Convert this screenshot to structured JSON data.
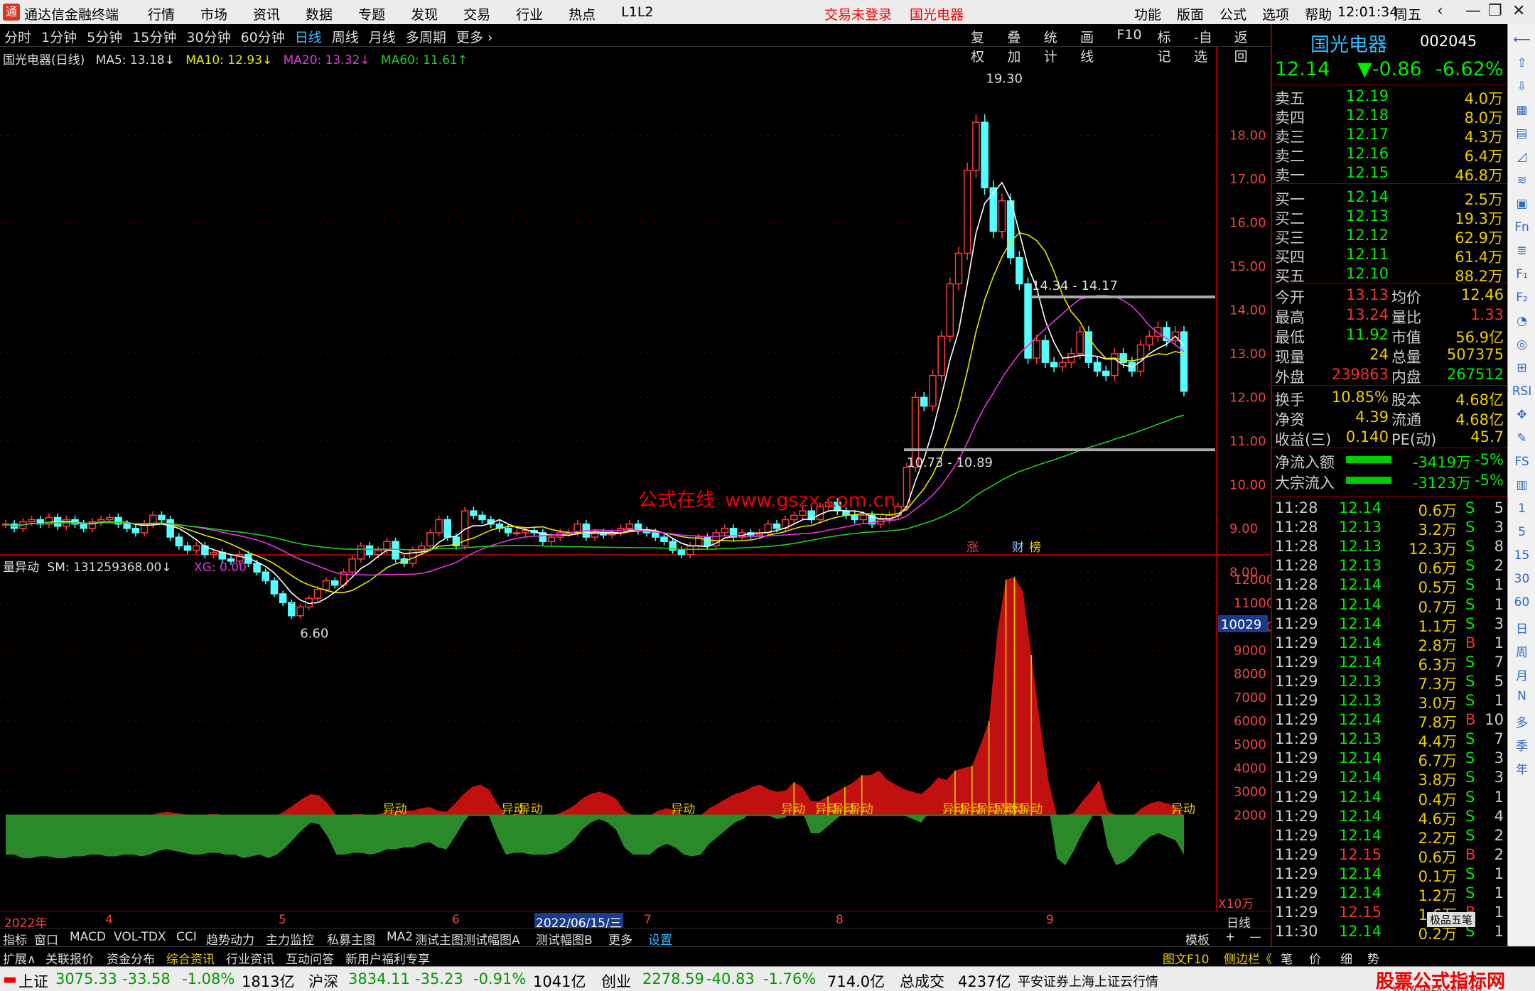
{
  "app": {
    "title": "通达信金融终端",
    "logo": "通",
    "menu": [
      "行情",
      "市场",
      "资讯",
      "数据",
      "专题",
      "发现",
      "交易",
      "行业",
      "热点",
      "L1L2"
    ],
    "status_red": "交易未登录",
    "stock_red": "国光电器",
    "right_menu": [
      "功能",
      "版面",
      "公式",
      "选项",
      "帮助"
    ],
    "clock": "12:01:34",
    "weekday": "周五",
    "window_buttons": [
      "‹",
      "—",
      "❐",
      "✕"
    ]
  },
  "period_tabs": [
    "分时",
    "1分钟",
    "5分钟",
    "15分钟",
    "30分钟",
    "60分钟",
    "日线",
    "周线",
    "月线",
    "多周期",
    "更多 ›"
  ],
  "active_period": "日线",
  "tools": [
    "复权",
    "叠加",
    "统计",
    "画线",
    "F10",
    "标记",
    "-自选",
    "返回"
  ],
  "legend": {
    "stock": "国光电器(日线)",
    "ma5": "MA5: 13.18↓",
    "ma10": "MA10: 12.93↓",
    "ma20": "MA20: 13.32↓",
    "ma60": "MA60: 11.61↑"
  },
  "chart_data": [
    {
      "type": "candlestick",
      "axis_ticks": [
        "18.00",
        "17.00",
        "16.00",
        "15.00",
        "14.00",
        "13.00",
        "12.00",
        "11.00",
        "10.00",
        "9.00",
        "8.00"
      ],
      "ylim": [
        7.5,
        19.7
      ],
      "annotations": {
        "high": "19.30",
        "low": "6.60",
        "upper_band": "14.34 - 14.17",
        "lower_band": "10.73 - 10.89"
      },
      "marks": [
        "涨",
        "财",
        "榜"
      ],
      "closes": [
        9.1,
        9.0,
        9.15,
        9.2,
        9.1,
        9.25,
        9.05,
        9.2,
        9.1,
        9.0,
        9.15,
        9.2,
        9.25,
        9.1,
        9.0,
        8.9,
        9.1,
        9.3,
        9.2,
        8.8,
        8.6,
        8.5,
        8.6,
        8.4,
        8.45,
        8.3,
        8.25,
        8.4,
        8.2,
        8.0,
        7.8,
        7.5,
        7.3,
        7.0,
        7.2,
        7.4,
        7.6,
        7.8,
        7.7,
        8.0,
        8.3,
        8.6,
        8.4,
        8.5,
        8.7,
        8.3,
        8.2,
        8.5,
        8.6,
        8.9,
        9.2,
        8.8,
        8.6,
        9.4,
        9.3,
        9.2,
        9.1,
        9.0,
        8.9,
        8.9,
        8.95,
        8.9,
        8.7,
        8.8,
        8.9,
        8.9,
        9.1,
        8.8,
        8.9,
        8.85,
        8.9,
        9.0,
        9.1,
        8.95,
        8.9,
        8.8,
        8.7,
        8.5,
        8.4,
        8.6,
        8.8,
        8.6,
        8.9,
        9.0,
        8.8,
        8.9,
        8.85,
        8.9,
        9.1,
        9.0,
        9.2,
        9.3,
        9.4,
        9.2,
        9.5,
        9.6,
        9.4,
        9.3,
        9.2,
        9.3,
        9.1,
        9.2,
        9.3,
        9.5,
        10.4,
        12.0,
        11.8,
        12.5,
        13.4,
        14.6,
        15.3,
        17.2,
        18.3,
        16.8,
        15.8,
        16.5,
        15.2,
        14.6,
        12.9,
        13.3,
        12.8,
        12.7,
        12.8,
        13.0,
        13.5,
        12.8,
        12.6,
        12.5,
        13.0,
        12.8,
        12.6,
        13.2,
        13.4,
        13.6,
        13.3,
        13.5,
        12.14
      ],
      "ma": [
        {
          "name": "MA5",
          "color": "#ffffff"
        },
        {
          "name": "MA10",
          "color": "#e6e600"
        },
        {
          "name": "MA20",
          "color": "#e633e6"
        },
        {
          "name": "MA60",
          "color": "#22cc22"
        }
      ]
    },
    {
      "type": "area",
      "title": "量异动",
      "axis_ticks": [
        "12000",
        "11000",
        "10000",
        "9000",
        "8000",
        "7000",
        "6000",
        "5000",
        "4000",
        "3000",
        "2000"
      ],
      "ylim": [
        0,
        12300
      ],
      "scale_unit": "X10万",
      "current_marker": "10029",
      "signal_label": "异动",
      "values": [
        2000,
        2000,
        1900,
        1900,
        1950,
        1950,
        1900,
        1900,
        1950,
        1950,
        2000,
        2000,
        1950,
        1950,
        2000,
        2000,
        1950,
        2000,
        2100,
        2150,
        2100,
        2050,
        2000,
        2000,
        2050,
        2050,
        2000,
        2000,
        1900,
        1950,
        2000,
        1900,
        2000,
        2200,
        2450,
        2700,
        2900,
        2850,
        2500,
        2000,
        2000,
        2050,
        2050,
        2000,
        2050,
        2150,
        2150,
        2200,
        2200,
        2300,
        2350,
        2200,
        2150,
        2500,
        2900,
        3200,
        3300,
        3100,
        2500,
        2000,
        2050,
        2050,
        2000,
        2000,
        2000,
        2050,
        2200,
        2400,
        2700,
        2900,
        3000,
        2900,
        2700,
        2200,
        2000,
        2000,
        2000,
        2200,
        2300,
        2200,
        2000,
        1950,
        2000,
        2300,
        2500,
        2700,
        2900,
        3000,
        3200,
        3300,
        3100,
        3000,
        3050,
        3400,
        3200,
        2600,
        2600,
        2800,
        3000,
        3200,
        3400,
        3700,
        3700,
        3900,
        3500,
        3300,
        3100,
        3000,
        2900,
        3200,
        3600,
        3500,
        3900,
        4000,
        4100,
        5000,
        6000,
        9800,
        12000,
        12100,
        11500,
        8800,
        6000,
        3500,
        1900,
        1600,
        2100,
        2600,
        3000,
        3500,
        2200,
        1700,
        1800,
        2000,
        2300,
        2500,
        2600,
        2500,
        2400,
        2000
      ]
    },
    {
      "type": "table",
      "name": "order_book",
      "sell": [
        [
          "卖五",
          "12.19",
          "4.0万"
        ],
        [
          "卖四",
          "12.18",
          "8.0万"
        ],
        [
          "卖三",
          "12.17",
          "4.3万"
        ],
        [
          "卖二",
          "12.16",
          "6.4万"
        ],
        [
          "卖一",
          "12.15",
          "46.8万"
        ]
      ],
      "buy": [
        [
          "买一",
          "12.14",
          "2.5万"
        ],
        [
          "买二",
          "12.13",
          "19.3万"
        ],
        [
          "买三",
          "12.12",
          "62.9万"
        ],
        [
          "买四",
          "12.11",
          "61.4万"
        ],
        [
          "买五",
          "12.10",
          "88.2万"
        ]
      ]
    },
    {
      "type": "table",
      "name": "ticks",
      "rows": [
        [
          "11:28",
          "12.14",
          "0.6万",
          "S",
          "5"
        ],
        [
          "11:28",
          "12.13",
          "3.2万",
          "S",
          "3"
        ],
        [
          "11:28",
          "12.13",
          "12.3万",
          "S",
          "8"
        ],
        [
          "11:28",
          "12.13",
          "0.6万",
          "S",
          "2"
        ],
        [
          "11:28",
          "12.14",
          "0.5万",
          "S",
          "1"
        ],
        [
          "11:28",
          "12.14",
          "0.7万",
          "S",
          "1"
        ],
        [
          "11:29",
          "12.14",
          "1.1万",
          "S",
          "3"
        ],
        [
          "11:29",
          "12.14",
          "2.8万",
          "B",
          "1"
        ],
        [
          "11:29",
          "12.14",
          "6.3万",
          "S",
          "7"
        ],
        [
          "11:29",
          "12.13",
          "7.3万",
          "S",
          "5"
        ],
        [
          "11:29",
          "12.13",
          "3.0万",
          "S",
          "1"
        ],
        [
          "11:29",
          "12.14",
          "7.8万",
          "B",
          "10"
        ],
        [
          "11:29",
          "12.13",
          "4.4万",
          "S",
          "7"
        ],
        [
          "11:29",
          "12.14",
          "6.7万",
          "S",
          "3"
        ],
        [
          "11:29",
          "12.14",
          "3.8万",
          "S",
          "3"
        ],
        [
          "11:29",
          "12.14",
          "0.4万",
          "S",
          "1"
        ],
        [
          "11:29",
          "12.14",
          "4.6万",
          "S",
          "4"
        ],
        [
          "11:29",
          "12.14",
          "2.2万",
          "S",
          "2"
        ],
        [
          "11:29",
          "12.15",
          "0.6万",
          "B",
          "2"
        ],
        [
          "11:29",
          "12.14",
          "0.1万",
          "S",
          "1"
        ],
        [
          "11:29",
          "12.14",
          "1.2万",
          "S",
          "1"
        ],
        [
          "11:29",
          "12.15",
          "1.6万",
          "B",
          "1"
        ],
        [
          "11:30",
          "12.14",
          "0.2万",
          "S",
          "1"
        ]
      ]
    }
  ],
  "indicator_legend": {
    "name": "量异动",
    "sm": "SM: 131259368.00↓",
    "xg": "XG: 0.00"
  },
  "watermark": {
    "cn": "公式在线",
    "url": "www.gszx.com.cn"
  },
  "date_axis": {
    "year": "2022年",
    "m4": "4",
    "m5": "5",
    "m6": "6",
    "selected": "2022/06/15/三",
    "m7": "7",
    "m8": "8",
    "m9": "9",
    "period": "日线"
  },
  "tabs2": [
    "指标",
    "窗口",
    "MACD",
    "VOL-TDX",
    "CCI",
    "趋势动力",
    "主力监控",
    "私募主图",
    "MA2",
    "测试主图",
    "测试幅图A",
    "测试幅图B",
    "更多",
    "设置"
  ],
  "tabs2_right": {
    "template": "模板",
    "plus": "+",
    "minus": "—"
  },
  "tabs3": [
    "扩展∧",
    "关联报价",
    "资金分布",
    "综合资讯",
    "行业资讯",
    "互动问答",
    "新用户福利专享"
  ],
  "tabs3_right": [
    "图文F10",
    "侧边栏《",
    "笔",
    "价",
    "细",
    "势"
  ],
  "status": {
    "sh": "上证",
    "sh_v": "3075.33",
    "sh_c": "-33.58",
    "sh_p": "-1.08%",
    "sh_a": "1813亿",
    "hs": "沪深",
    "hs_v": "3834.11",
    "hs_c": "-35.23",
    "hs_p": "-0.91%",
    "hs_a": "1041亿",
    "cy": "创业",
    "cy_v": "2278.59",
    "cy_c": "-40.83",
    "cy_p": "-1.76%",
    "cy_a": "714.0亿",
    "zz": "总成交",
    "zz_a": "4237亿",
    "src": "平安证券上海上证云行情",
    "brand": "股票公式指标网",
    "brand_url": "www.gszx.com.cn"
  },
  "quote": {
    "name": "国光电器",
    "code": "002045",
    "last": "12.14",
    "chg": "▼-0.86",
    "pct": "-6.62%",
    "stats": [
      [
        "今开",
        "13.13",
        "均价",
        "12.46"
      ],
      [
        "最高",
        "13.24",
        "量比",
        "1.33"
      ],
      [
        "最低",
        "11.92",
        "市值",
        "56.9亿"
      ],
      [
        "现量",
        "24",
        "总量",
        "507375"
      ],
      [
        "外盘",
        "239863",
        "内盘",
        "267512"
      ]
    ],
    "fund": [
      [
        "换手",
        "10.85%",
        "股本",
        "4.68亿"
      ],
      [
        "净资",
        "4.39",
        "流通",
        "4.68亿"
      ],
      [
        "收益(三)",
        "0.140",
        "PE(动)",
        "45.7"
      ]
    ],
    "flow": [
      [
        "净流入额",
        "-3419万",
        "-5%"
      ],
      [
        "大宗流入",
        "-3123万",
        "-5%"
      ]
    ],
    "popup": "极品五笔"
  },
  "side_icons": [
    "⟵",
    "⇧",
    "⇩",
    "▦",
    "▤",
    "◿",
    "≋",
    "▣",
    "Fn",
    "≣",
    "F₁",
    "F₂",
    "◔",
    "◎",
    "⊞",
    "RSI",
    "✥",
    "✎",
    "FS",
    "▥",
    "1",
    "5",
    "15",
    "30",
    "60",
    "日",
    "周",
    "月",
    "N",
    "多",
    "季",
    "年"
  ]
}
